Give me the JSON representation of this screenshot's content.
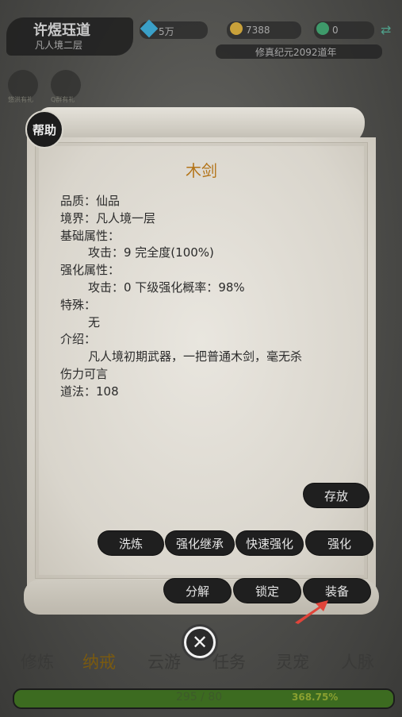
{
  "header": {
    "player_name": "许煜珏道",
    "realm": "凡人境二层",
    "resources": [
      {
        "icon": "blue-gem-icon",
        "value": "5万",
        "color": "#3aa0c8"
      },
      {
        "icon": "gold-coin-icon",
        "value": "7388",
        "color": "#c9a13a"
      },
      {
        "icon": "green-jade-icon",
        "value": "0",
        "color": "#3e9a6a"
      }
    ],
    "era": "修真纪元2092道年"
  },
  "side": {
    "left_labels": [
      "悠洪有礼",
      "Q群有礼"
    ]
  },
  "item": {
    "help_label": "帮助",
    "name": "木剑",
    "lines": [
      {
        "text": "品质：仙品",
        "indent": false
      },
      {
        "text": "境界：凡人境一层",
        "indent": false
      },
      {
        "text": "基础属性：",
        "indent": false
      },
      {
        "text": "攻击：9  完全度(100%)",
        "indent": true
      },
      {
        "text": "强化属性：",
        "indent": false
      },
      {
        "text": "攻击：0   下级强化概率：98%",
        "indent": true
      },
      {
        "text": "特殊：",
        "indent": false
      },
      {
        "text": "无",
        "indent": true
      },
      {
        "text": "介绍：",
        "indent": false
      },
      {
        "text": "凡人境初期武器，一把普通木剑，毫无杀",
        "indent": true
      },
      {
        "text": "伤力可言",
        "indent": false
      },
      {
        "text": "道法：108",
        "indent": false
      }
    ]
  },
  "buttons": {
    "store": "存放",
    "reroll": "洗炼",
    "inherit": "强化继承",
    "quick_enhance": "快速强化",
    "enhance": "强化",
    "decompose": "分解",
    "lock": "锁定",
    "equip": "装备"
  },
  "nav": [
    "修炼",
    "纳戒",
    "云游",
    "任务",
    "灵宠",
    "人脉"
  ],
  "progress": {
    "text": "295 / 80",
    "percent_text": "368.75%",
    "fill_fraction": 1.0
  }
}
